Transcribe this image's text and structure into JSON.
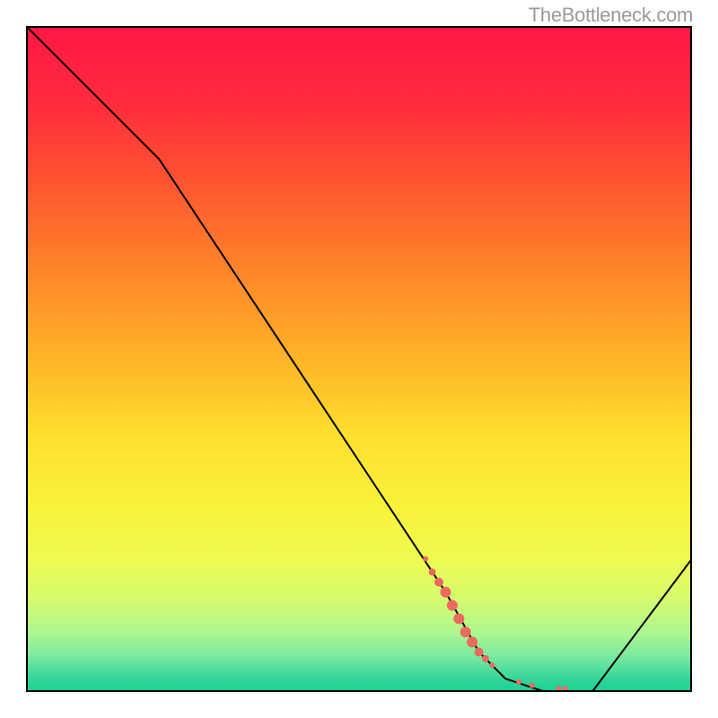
{
  "watermark": "TheBottleneck.com",
  "chart_data": {
    "type": "line",
    "title": "",
    "xlabel": "",
    "ylabel": "",
    "xlim": [
      0,
      100
    ],
    "ylim": [
      0,
      100
    ],
    "series": [
      {
        "name": "bottleneck-curve",
        "x": [
          0,
          20,
          63,
          68,
          72,
          78,
          85,
          100
        ],
        "values": [
          100,
          80,
          15,
          6,
          2,
          0,
          0,
          20
        ]
      }
    ],
    "markers": {
      "name": "highlighted-points",
      "color": "#ec6a5e",
      "points": [
        {
          "x": 60,
          "y": 20,
          "r": 3
        },
        {
          "x": 61,
          "y": 18,
          "r": 4
        },
        {
          "x": 62,
          "y": 16.5,
          "r": 5
        },
        {
          "x": 63,
          "y": 15,
          "r": 6
        },
        {
          "x": 64,
          "y": 13,
          "r": 6
        },
        {
          "x": 65,
          "y": 11,
          "r": 6
        },
        {
          "x": 66,
          "y": 9,
          "r": 6
        },
        {
          "x": 67,
          "y": 7.5,
          "r": 6
        },
        {
          "x": 68,
          "y": 6,
          "r": 5
        },
        {
          "x": 69,
          "y": 5,
          "r": 4
        },
        {
          "x": 70,
          "y": 4,
          "r": 3
        },
        {
          "x": 74,
          "y": 1.5,
          "r": 3
        },
        {
          "x": 76,
          "y": 1,
          "r": 3
        },
        {
          "x": 80,
          "y": 0.5,
          "r": 3
        },
        {
          "x": 81,
          "y": 0.5,
          "r": 3
        }
      ]
    },
    "gradient_stops": [
      {
        "offset": 0.0,
        "color": "#ff1744"
      },
      {
        "offset": 0.12,
        "color": "#ff2c3e"
      },
      {
        "offset": 0.25,
        "color": "#ff5a2f"
      },
      {
        "offset": 0.38,
        "color": "#ff8a28"
      },
      {
        "offset": 0.5,
        "color": "#ffb427"
      },
      {
        "offset": 0.62,
        "color": "#ffe12e"
      },
      {
        "offset": 0.72,
        "color": "#f8f23a"
      },
      {
        "offset": 0.8,
        "color": "#eefb50"
      },
      {
        "offset": 0.86,
        "color": "#d5fb6e"
      },
      {
        "offset": 0.91,
        "color": "#aef88f"
      },
      {
        "offset": 0.95,
        "color": "#73e8a0"
      },
      {
        "offset": 0.98,
        "color": "#35d69a"
      },
      {
        "offset": 1.0,
        "color": "#18cf94"
      }
    ]
  }
}
